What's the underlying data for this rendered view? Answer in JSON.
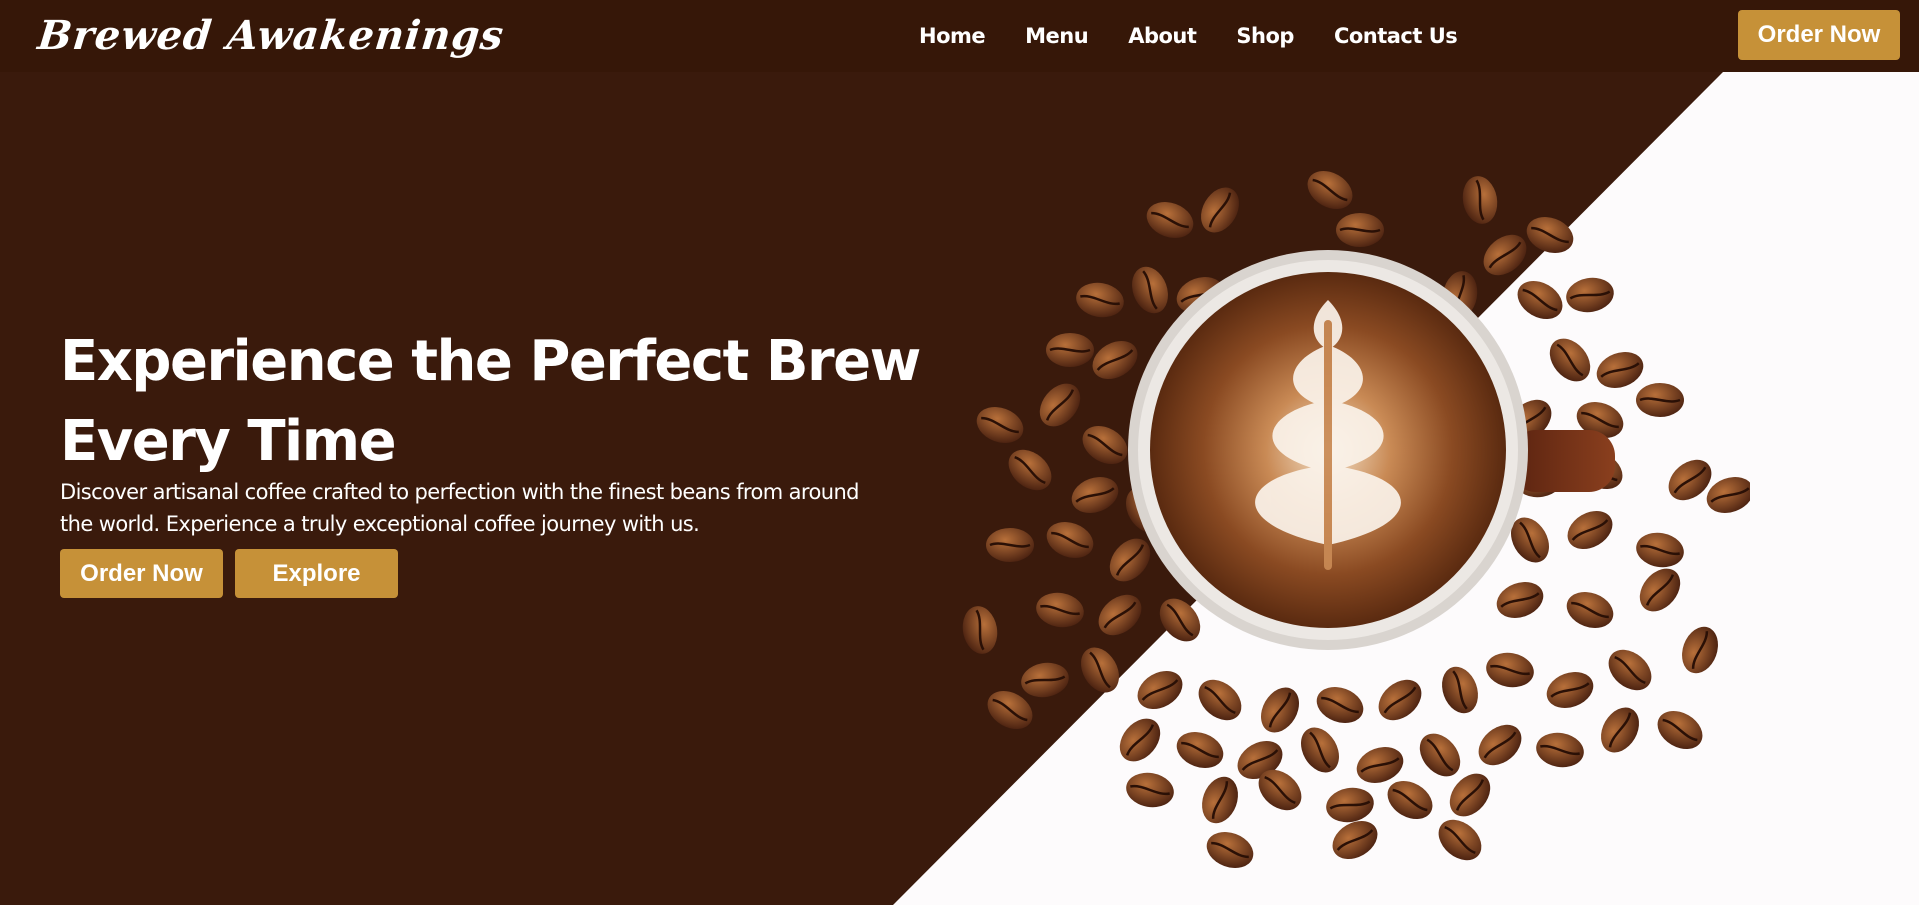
{
  "brand": {
    "name": "Brewed Awakenings"
  },
  "nav": {
    "items": [
      {
        "label": "Home"
      },
      {
        "label": "Menu"
      },
      {
        "label": "About"
      },
      {
        "label": "Shop"
      },
      {
        "label": "Contact Us"
      }
    ],
    "cta_label": "Order Now"
  },
  "hero": {
    "title_line1": "Experience the Perfect Brew",
    "title_line2": "Every Time",
    "subtitle_line1": "Discover artisanal coffee crafted to perfection with the finest beans from around",
    "subtitle_line2": "the world. Experience a truly exceptional coffee journey with us.",
    "primary_button": "Order Now",
    "secondary_button": "Explore",
    "image_icon": "latte-art-coffee-cup-with-beans"
  },
  "colors": {
    "background_dark": "#3a1a0c",
    "header": "#361708",
    "accent": "#c69138",
    "panel_light": "#fdfbfc"
  }
}
